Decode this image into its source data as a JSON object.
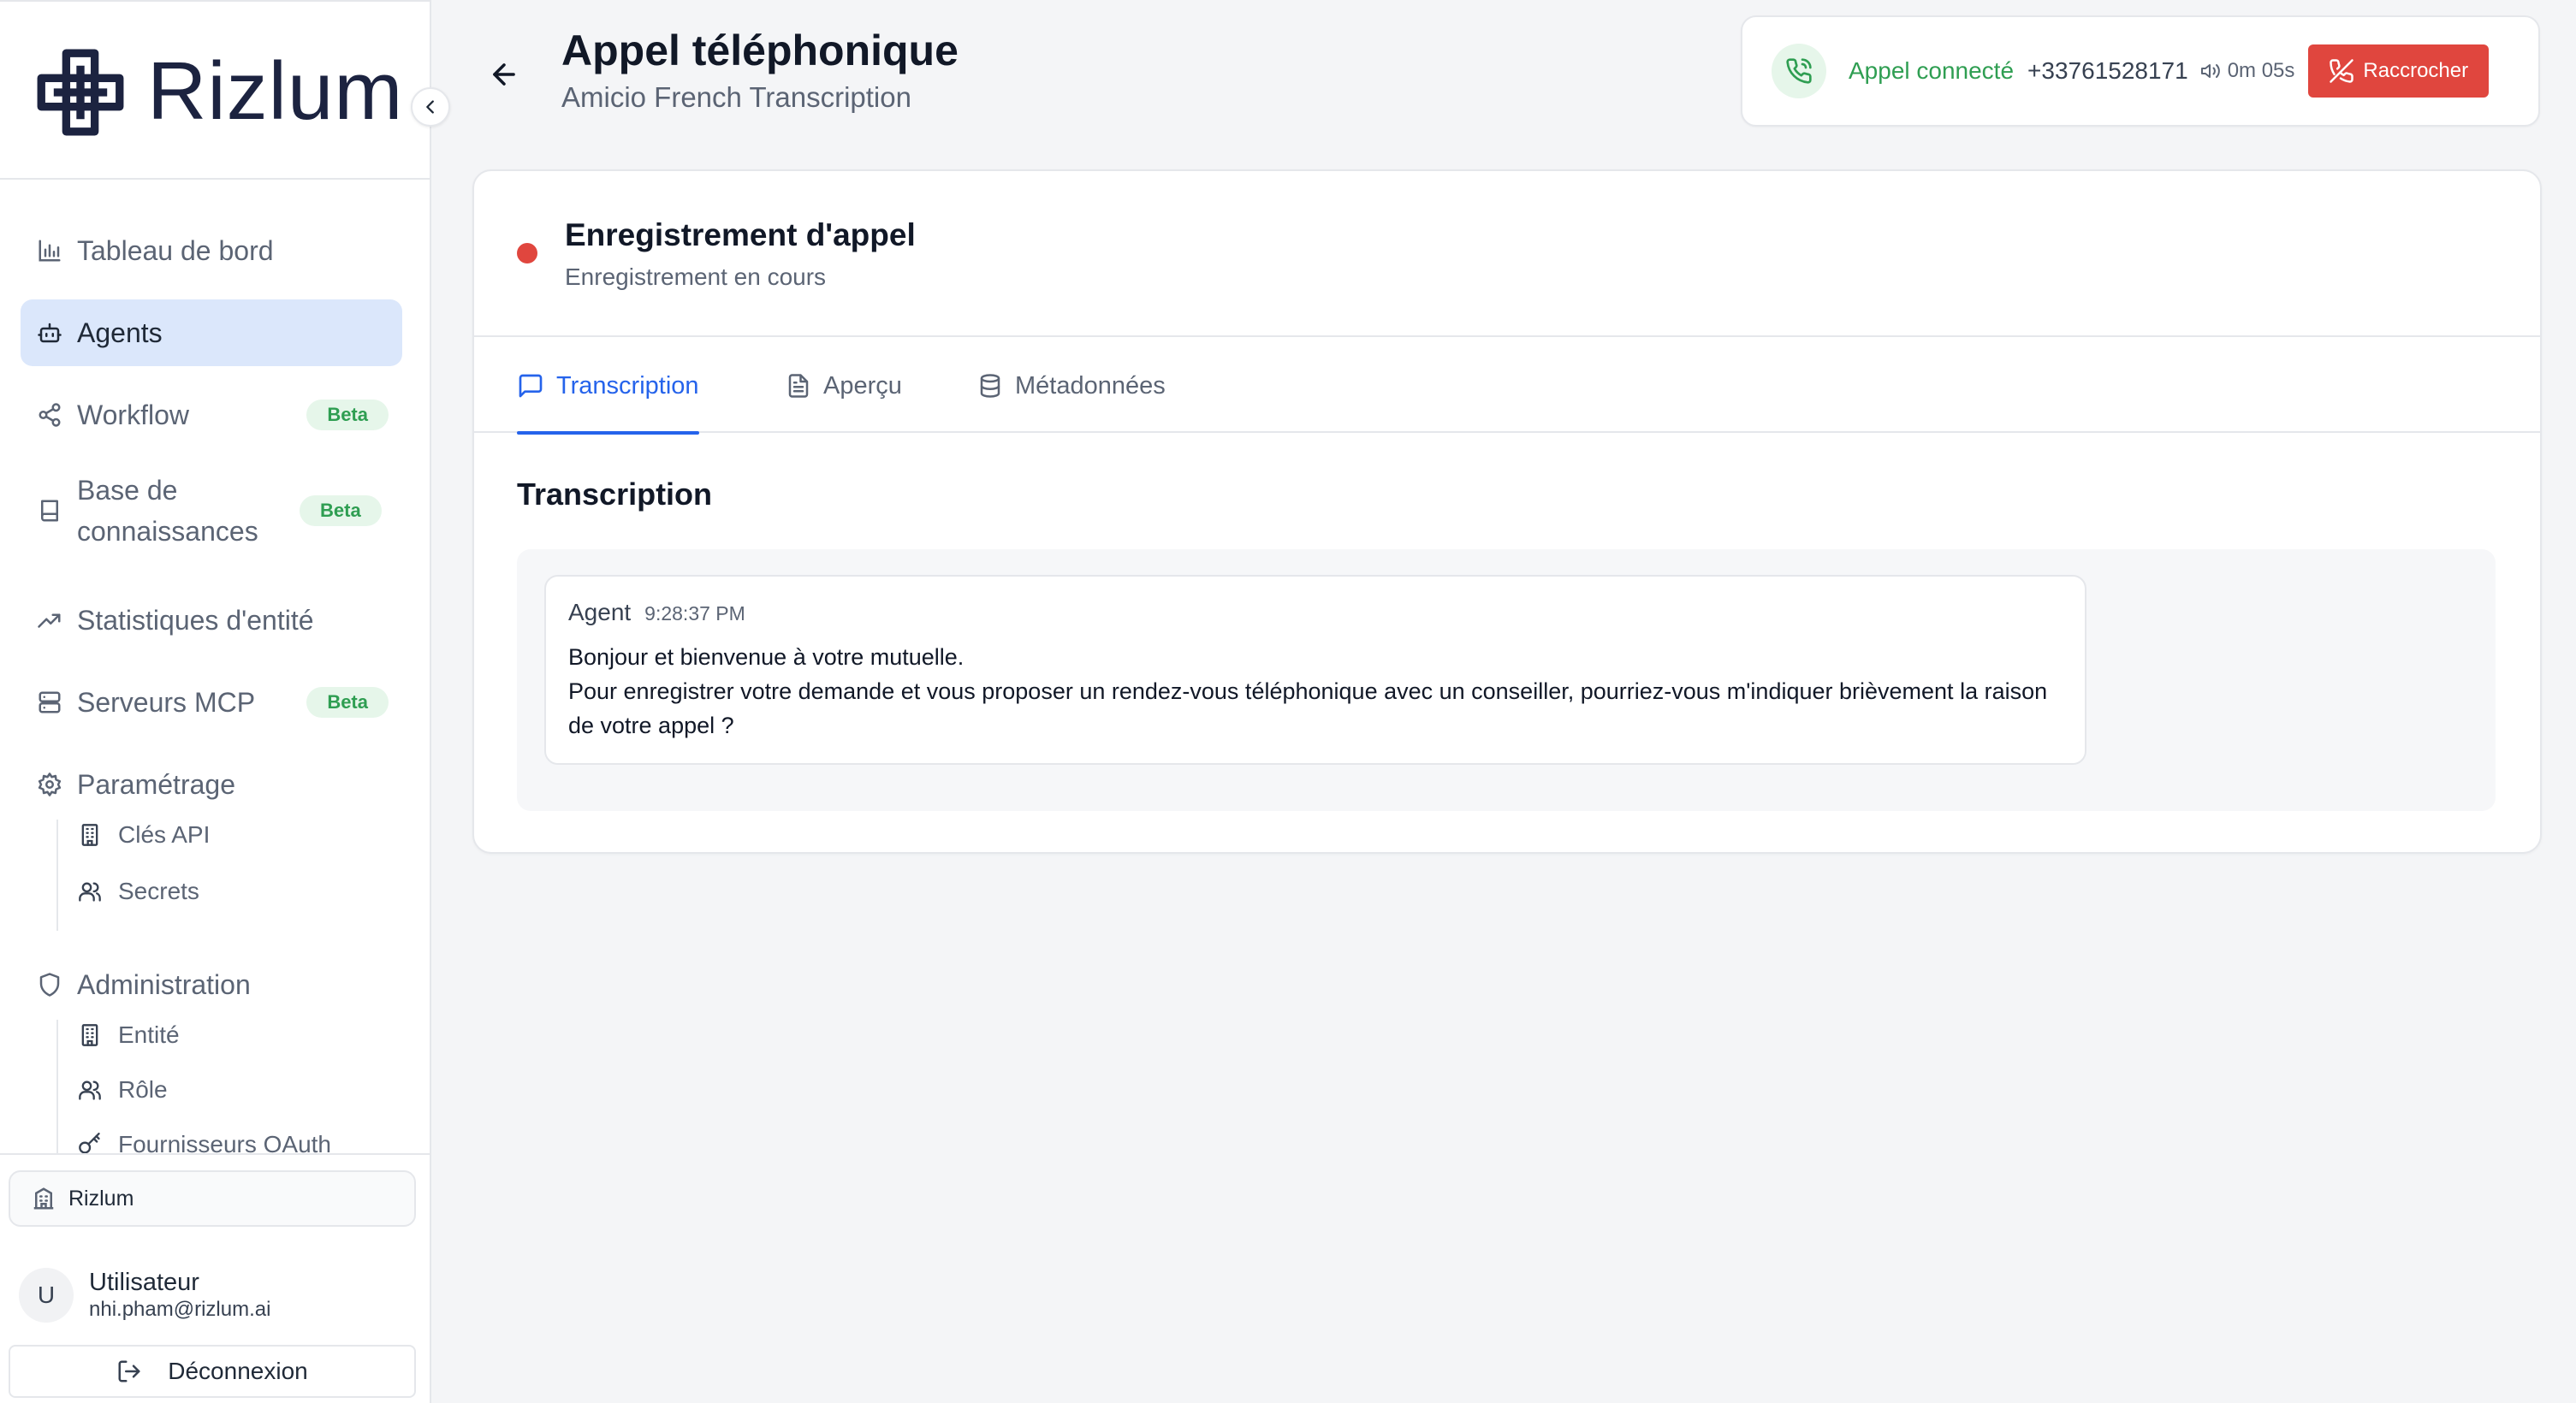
{
  "brand": {
    "name": "Rizlum"
  },
  "sidebar": {
    "items": [
      {
        "label": "Tableau de bord"
      },
      {
        "label": "Agents"
      },
      {
        "label": "Workflow",
        "badge": "Beta"
      },
      {
        "label": "Base de connaissances",
        "badge": "Beta"
      },
      {
        "label": "Statistiques d'entité"
      },
      {
        "label": "Serveurs MCP",
        "badge": "Beta"
      },
      {
        "label": "Paramétrage"
      },
      {
        "label": "Administration"
      }
    ],
    "settings_sub": [
      {
        "label": "Clés API"
      },
      {
        "label": "Secrets"
      }
    ],
    "admin_sub": [
      {
        "label": "Entité"
      },
      {
        "label": "Rôle"
      },
      {
        "label": "Fournisseurs OAuth"
      }
    ],
    "organization": "Rizlum",
    "user": {
      "initial": "U",
      "name": "Utilisateur",
      "email": "nhi.pham@rizlum.ai"
    },
    "logout_label": "Déconnexion"
  },
  "header": {
    "title": "Appel téléphonique",
    "subtitle": "Amicio French Transcription"
  },
  "call": {
    "status": "Appel connecté",
    "number": "+33761528171",
    "duration": "0m 05s",
    "hangup_label": "Raccrocher"
  },
  "recording": {
    "title": "Enregistrement d'appel",
    "status": "Enregistrement en cours"
  },
  "tabs": [
    {
      "label": "Transcription"
    },
    {
      "label": "Aperçu"
    },
    {
      "label": "Métadonnées"
    }
  ],
  "transcript": {
    "title": "Transcription",
    "messages": [
      {
        "author": "Agent",
        "time": "9:28:37 PM",
        "line1": "Bonjour et bienvenue à votre mutuelle.",
        "line2": "Pour enregistrer votre demande et vous proposer un rendez-vous téléphonique avec un conseiller, pourriez-vous m'indiquer brièvement la raison de votre appel ?"
      }
    ]
  },
  "colors": {
    "accent": "#2563eb",
    "success": "#2f9e52",
    "danger": "#e0463e",
    "active_nav_bg": "#dbe7fb"
  }
}
